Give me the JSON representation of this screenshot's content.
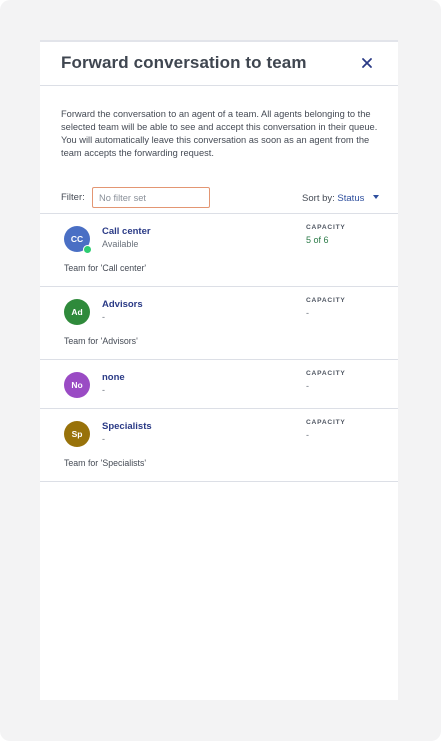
{
  "dialog": {
    "title": "Forward conversation to team",
    "close_icon": "close-icon",
    "description": "Forward the conversation to an agent of a team. All agents belonging to the selected team will be able to see and accept this conversation in their queue. You will automatically leave this conversation as soon as an agent from the team accepts the forwarding request."
  },
  "filter": {
    "label": "Filter:",
    "value": "",
    "placeholder": "No filter set"
  },
  "sort": {
    "label": "Sort by:",
    "value": "Status",
    "icon": "caret-down-icon"
  },
  "teams": [
    {
      "initials": "CC",
      "name": "Call center",
      "status": "Available",
      "capacity_label": "CAPACITY",
      "capacity": "5 of 6",
      "description": "Team for 'Call center'",
      "avatar_color": "#4a6fc4",
      "online": true
    },
    {
      "initials": "Ad",
      "name": "Advisors",
      "status": "-",
      "capacity_label": "CAPACITY",
      "capacity": "-",
      "description": "Team for 'Advisors'",
      "avatar_color": "#2f8a3b",
      "online": false
    },
    {
      "initials": "No",
      "name": "none",
      "status": "-",
      "capacity_label": "CAPACITY",
      "capacity": "-",
      "description": "",
      "avatar_color": "#9a4bc4",
      "online": false
    },
    {
      "initials": "Sp",
      "name": "Specialists",
      "status": "-",
      "capacity_label": "CAPACITY",
      "capacity": "-",
      "description": "Team for 'Specialists'",
      "avatar_color": "#98720a",
      "online": false
    }
  ],
  "colors": {
    "title": "#3f4650",
    "team_name": "#2a3a86",
    "capacity_ok": "#2a7a47",
    "filter_border": "#e39673",
    "sort_value": "#2e4f9e",
    "online_dot": "#2ecc71"
  }
}
